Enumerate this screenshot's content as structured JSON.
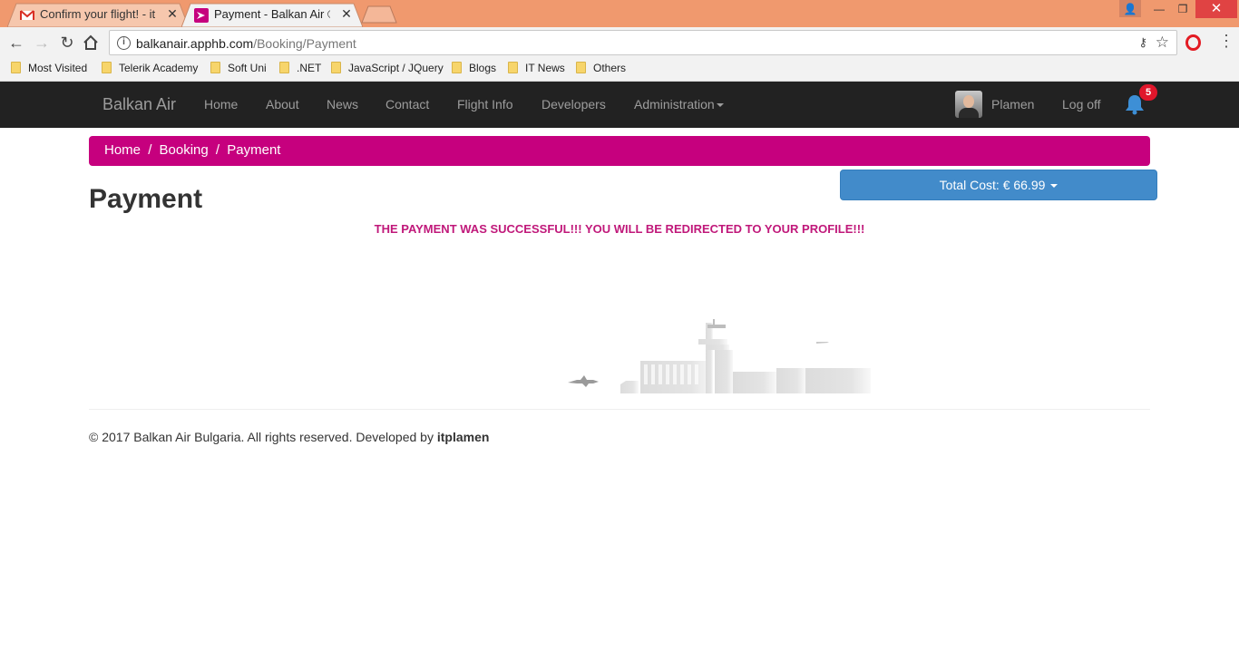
{
  "browser": {
    "tabs": [
      {
        "label": "Confirm your flight! - itplamen",
        "icon": "gmail-icon"
      },
      {
        "label": "Payment - Balkan Air ®",
        "icon": "balkan-air-favicon",
        "active": true
      }
    ],
    "url_host": "balkanair.apphb.com",
    "url_path": "/Booking/Payment",
    "bookmarks": [
      "Most Visited",
      "Telerik Academy",
      "Soft Uni",
      ".NET",
      "JavaScript / JQuery",
      "Blogs",
      "IT News",
      "Others"
    ]
  },
  "navbar": {
    "brand": "Balkan Air",
    "links": [
      "Home",
      "About",
      "News",
      "Contact",
      "Flight Info",
      "Developers",
      "Administration"
    ],
    "user_name": "Plamen",
    "logoff": "Log off",
    "notification_count": "5"
  },
  "breadcrumb": {
    "home": "Home",
    "sep1": "/",
    "booking": "Booking",
    "sep2": "/",
    "current": "Payment"
  },
  "page": {
    "title": "Payment",
    "total_cost": "Total Cost: € 66.99",
    "message": "THE PAYMENT WAS SUCCESSFUL!!! YOU WILL BE REDIRECTED TO YOUR PROFILE!!!"
  },
  "footer": {
    "text": "© 2017 Balkan Air Bulgaria. All rights reserved. Developed by",
    "author": "itplamen"
  },
  "colors": {
    "accent": "#c6007e",
    "button": "#428bca",
    "navbar": "#222222",
    "chrome": "#f0996e"
  }
}
